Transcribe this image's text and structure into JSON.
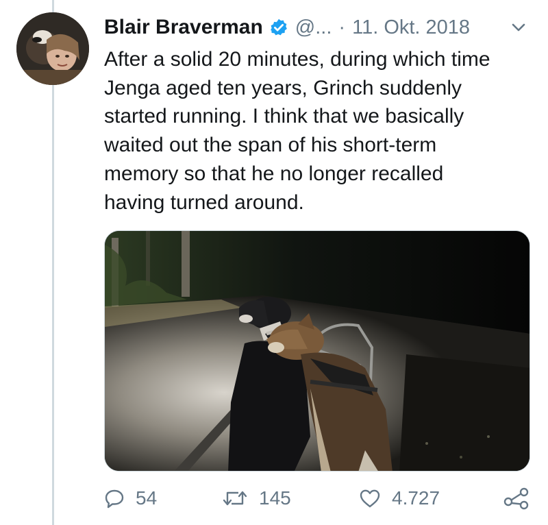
{
  "tweet": {
    "author_name": "Blair Braverman",
    "handle": "@...",
    "separator": "·",
    "date": "11. Okt. 2018",
    "text": "After a solid 20 minutes, during which time\nJenga aged ten years, Grinch suddenly\nstarted running. I think that we basically\nwaited out the span of his short-term\nmemory so that he no longer recalled\nhaving turned around."
  },
  "actions": {
    "reply_count": "54",
    "retweet_count": "145",
    "like_count": "4.727"
  },
  "colors": {
    "text_primary": "#14171a",
    "text_secondary": "#657786",
    "verified_blue": "#1da1f2",
    "thread_line": "#cfd9de"
  },
  "icons": [
    "avatar",
    "verified-badge-icon",
    "chevron-down-icon",
    "reply-icon",
    "retweet-icon",
    "like-icon",
    "share-icon"
  ]
}
